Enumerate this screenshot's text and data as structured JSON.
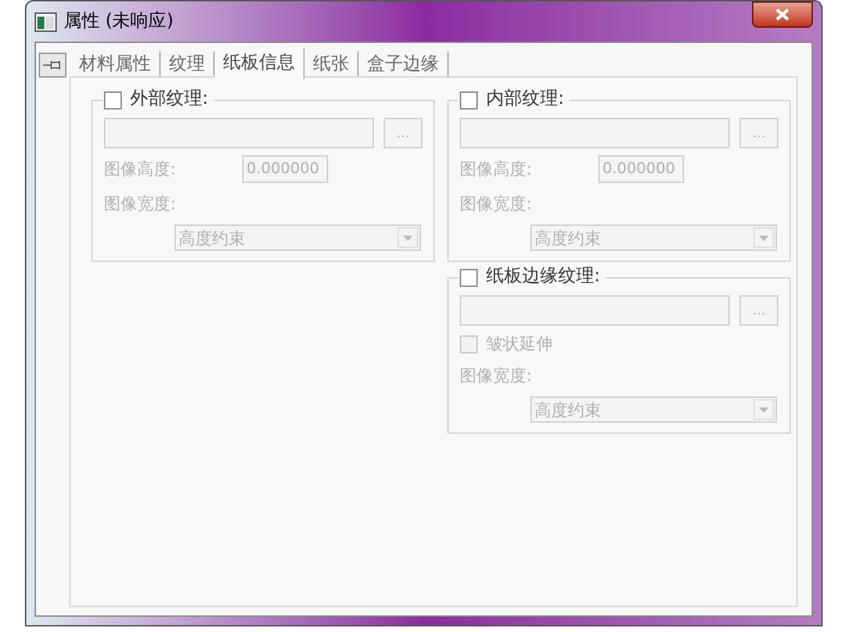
{
  "window": {
    "title": "属性 (未响应)"
  },
  "tabs": [
    {
      "label": "材料属性",
      "selected": false
    },
    {
      "label": "纹理",
      "selected": false
    },
    {
      "label": "纸板信息",
      "selected": true
    },
    {
      "label": "纸张",
      "selected": false
    },
    {
      "label": "盒子边缘",
      "selected": false
    }
  ],
  "groups": [
    {
      "label": "外部纹理:",
      "checked": false,
      "rows": [
        {
          "kind": "path",
          "button": "...",
          "disabled": true
        },
        {
          "kind": "number",
          "label": "图像高度:",
          "value": "0.000000",
          "disabled": true
        },
        {
          "kind": "label",
          "label": "图像宽度:",
          "disabled": true
        },
        {
          "kind": "select",
          "value": "高度约束",
          "disabled": true
        }
      ]
    },
    {
      "label": "内部纹理:",
      "checked": false,
      "rows": [
        {
          "kind": "path",
          "button": "...",
          "disabled": true
        },
        {
          "kind": "number",
          "label": "图像高度:",
          "value": "0.000000",
          "disabled": true
        },
        {
          "kind": "label",
          "label": "图像宽度:",
          "disabled": true
        },
        {
          "kind": "select",
          "value": "高度约束",
          "disabled": true
        }
      ]
    },
    {
      "label": "纸板边缘纹理:",
      "checked": false,
      "rows": [
        {
          "kind": "path",
          "button": "...",
          "disabled": true
        },
        {
          "kind": "checkbox",
          "label": "皱状延伸",
          "checked": false,
          "disabled": true
        },
        {
          "kind": "label",
          "label": "图像宽度:",
          "disabled": true
        },
        {
          "kind": "select",
          "value": "高度约束",
          "disabled": true
        }
      ]
    }
  ]
}
